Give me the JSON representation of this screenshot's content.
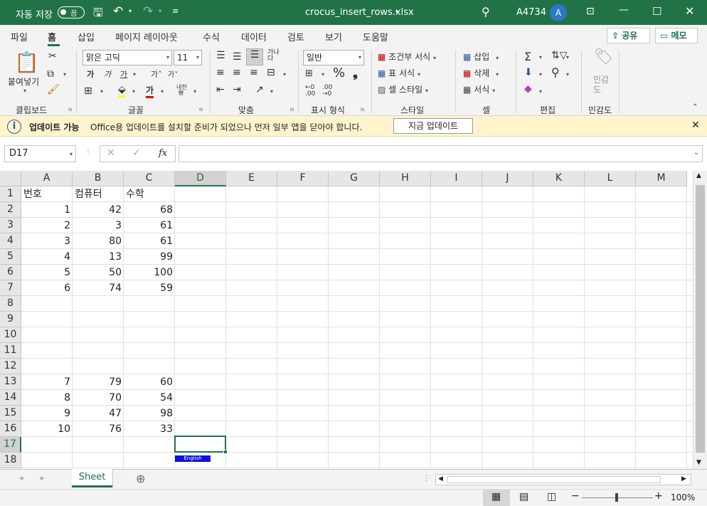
{
  "titlebar": {
    "autosave_label": "자동 저장",
    "autosave_state": "끔",
    "filename": "crocus_insert_rows.xlsx",
    "user_name": "A4734",
    "avatar_initial": "A"
  },
  "tabs": [
    "파일",
    "홈",
    "삽입",
    "페이지 레이아웃",
    "수식",
    "데이터",
    "검토",
    "보기",
    "도움말"
  ],
  "share_label": "공유",
  "comment_label": "메모",
  "ribbon": {
    "paste_label": "붙여넣기",
    "font_name": "맑은 고딕",
    "font_size": "11",
    "number_format": "일반",
    "cond_format": "조건부 서식",
    "table_format": "표 서식",
    "cell_style": "셀 스타일",
    "insert": "삽입",
    "delete": "삭제",
    "format": "서식",
    "sensitivity": "민감도",
    "groups": [
      "클립보드",
      "글꼴",
      "맞춤",
      "표시 형식",
      "스타일",
      "셀",
      "편집",
      "민감도"
    ]
  },
  "infobar": {
    "title": "업데이트 가능",
    "message": "Office용 업데이트를 설치할 준비가 되었으나 먼저 일부 앱을 닫아야 합니다.",
    "button": "지금 업데이트"
  },
  "formula_bar": {
    "name_box": "D17",
    "formula": ""
  },
  "columns": [
    "A",
    "B",
    "C",
    "D",
    "E",
    "F",
    "G",
    "H",
    "I",
    "J",
    "K",
    "L",
    "M"
  ],
  "selected_column": "D",
  "selected_row": 17,
  "rows": [
    {
      "n": "1",
      "a": "번호",
      "b": "컴퓨터",
      "c": "수학"
    },
    {
      "n": "2",
      "a": "1",
      "b": "42",
      "c": "68"
    },
    {
      "n": "3",
      "a": "2",
      "b": "3",
      "c": "61"
    },
    {
      "n": "4",
      "a": "3",
      "b": "80",
      "c": "61"
    },
    {
      "n": "5",
      "a": "4",
      "b": "13",
      "c": "99"
    },
    {
      "n": "6",
      "a": "5",
      "b": "50",
      "c": "100"
    },
    {
      "n": "7",
      "a": "6",
      "b": "74",
      "c": "59"
    },
    {
      "n": "8",
      "a": "",
      "b": "",
      "c": ""
    },
    {
      "n": "9",
      "a": "",
      "b": "",
      "c": ""
    },
    {
      "n": "10",
      "a": "",
      "b": "",
      "c": ""
    },
    {
      "n": "11",
      "a": "",
      "b": "",
      "c": ""
    },
    {
      "n": "12",
      "a": "",
      "b": "",
      "c": ""
    },
    {
      "n": "13",
      "a": "7",
      "b": "79",
      "c": "60"
    },
    {
      "n": "14",
      "a": "8",
      "b": "70",
      "c": "54"
    },
    {
      "n": "15",
      "a": "9",
      "b": "47",
      "c": "98"
    },
    {
      "n": "16",
      "a": "10",
      "b": "76",
      "c": "33"
    },
    {
      "n": "17",
      "a": "",
      "b": "",
      "c": ""
    },
    {
      "n": "18",
      "a": "",
      "b": "",
      "c": ""
    }
  ],
  "ime_indicator": "English",
  "sheet_tab": "Sheet",
  "zoom": "100%",
  "accent_color": "#217346"
}
